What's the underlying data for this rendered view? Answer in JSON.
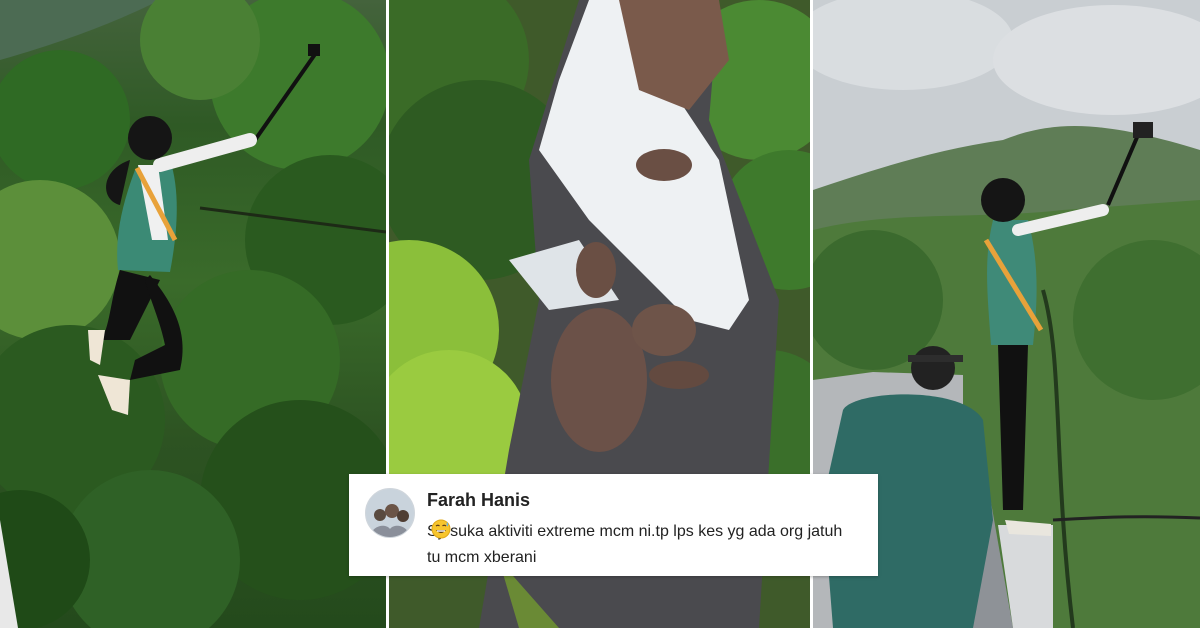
{
  "comment": {
    "name": "Farah Hanis",
    "text": "Sy suka aktiviti extreme mcm ni.tp lps kes yg ada org jatuh tu mcm xberani",
    "emoji": "grinning-sweat-emoji"
  },
  "colors": {
    "forest": "#2f5a25",
    "sky": "#cfd3d6",
    "water": "#e8ecee",
    "card": "#ffffff"
  }
}
